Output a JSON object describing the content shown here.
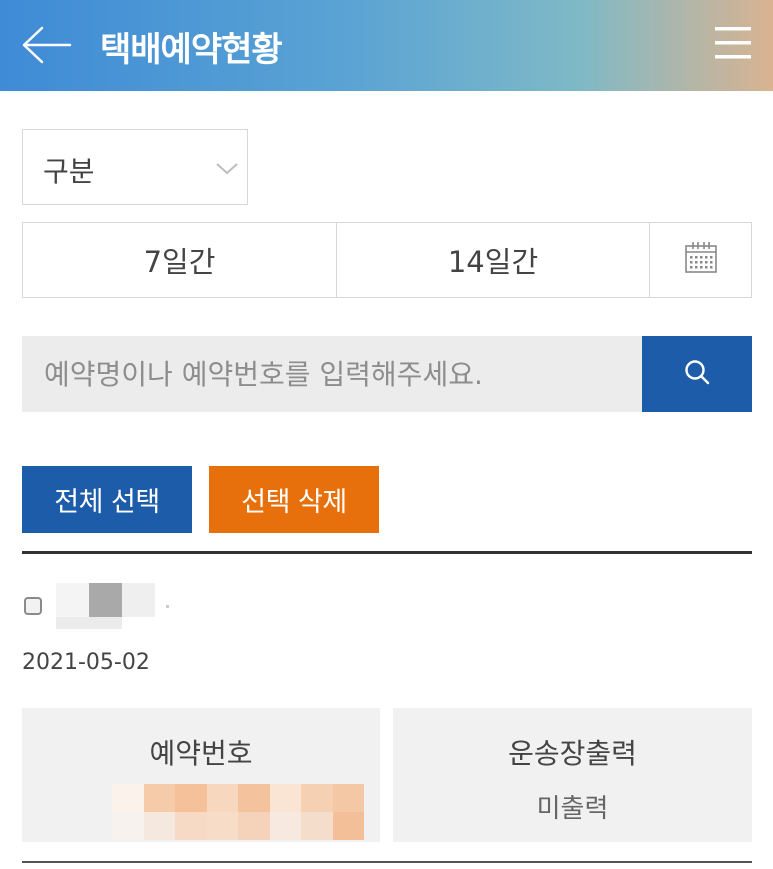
{
  "header": {
    "title": "택배예약현황",
    "back_icon": "back-arrow-icon",
    "menu_icon": "hamburger-menu-icon",
    "gradient": [
      "#3f8bd6",
      "#7fb9c6",
      "#d9b391"
    ]
  },
  "filter": {
    "category_value": "구분",
    "category_icon": "chevron-down-icon",
    "period_7": "7일간",
    "period_14": "14일간",
    "calendar_icon": "calendar-icon"
  },
  "search": {
    "placeholder": "예약명이나 예약번호를 입력해주세요.",
    "value": "",
    "icon": "search-icon"
  },
  "actions": {
    "select_all": "전체 선택",
    "delete_selected": "선택 삭제"
  },
  "reservation": {
    "date": "2021-05-02",
    "reservation_number_label": "예약번호",
    "waybill_label": "운송장출력",
    "waybill_status": "미출력"
  },
  "colors": {
    "primary": "#1d5ca8",
    "accent": "#e8700c",
    "card_bg": "#f1f1f1"
  }
}
